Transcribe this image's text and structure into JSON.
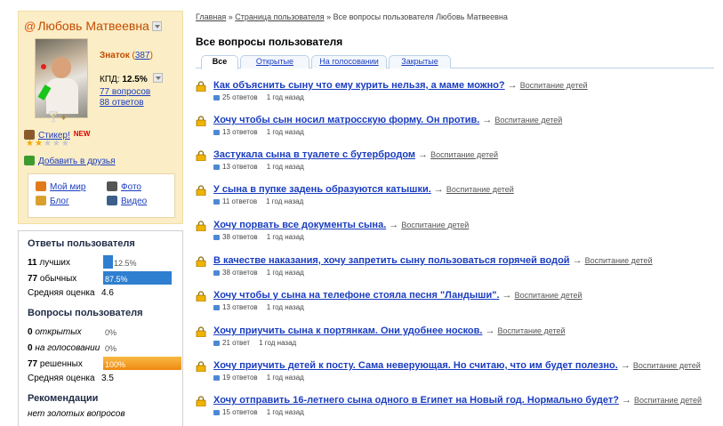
{
  "profile": {
    "name": "Любовь Матвеевна",
    "rank": "Знаток",
    "points": "387",
    "kpd_label": "КПД:",
    "kpd_value": "12.5%",
    "questions_link": "77 вопросов",
    "answers_link": "88 ответов",
    "sticker": "Стикер!",
    "sticker_badge": "NEW",
    "stars_on": 2,
    "stars_total": 5,
    "add_friend": "Добавить в друзья",
    "links": {
      "my_world": "Мой мир",
      "photo": "Фото",
      "blog": "Блог",
      "video": "Видео"
    }
  },
  "stats": {
    "answers_title": "Ответы пользователя",
    "best_count": "11",
    "best_label": "лучших",
    "best_pct": "12.5%",
    "best_fraction": 0.125,
    "usual_count": "77",
    "usual_label": "обычных",
    "usual_pct": "87.5%",
    "usual_fraction": 0.875,
    "avg_label": "Средняя оценка",
    "avg_answers": "4.6",
    "questions_title": "Вопросы пользователя",
    "open_count": "0",
    "open_label": "открытых",
    "open_pct": "0%",
    "vote_count": "0",
    "vote_label": "на голосовании",
    "vote_pct": "0%",
    "solved_count": "77",
    "solved_label": "решенных",
    "solved_pct": "100%",
    "solved_fraction": 1.0,
    "avg_questions": "3.5",
    "rec_title": "Рекомендации",
    "rec_text": "нет золотых вопросов"
  },
  "breadcrumb": {
    "home": "Главная",
    "sep": " » ",
    "user_page": "Страница пользователя",
    "current": "Все вопросы пользователя Любовь Матвеевна"
  },
  "page_title": "Все вопросы пользователя",
  "tabs": [
    "Все",
    "Открытые",
    "На голосовании",
    "Закрытые"
  ],
  "questions": [
    {
      "title": "Как объяснить сыну что ему курить нельзя, а маме можно?",
      "category": "Воспитание детей",
      "answers": "25 ответов",
      "time": "1 год назад"
    },
    {
      "title": "Хочу чтобы сын носил матросскую форму. Он против.",
      "category": "Воспитание детей",
      "answers": "13 ответов",
      "time": "1 год назад"
    },
    {
      "title": "Застукала сына в туалете с бутербродом",
      "category": "Воспитание детей",
      "answers": "13 ответов",
      "time": "1 год назад"
    },
    {
      "title": "У сына в пупке задень образуются катышки.",
      "category": "Воспитание детей",
      "answers": "11 ответов",
      "time": "1 год назад"
    },
    {
      "title": "Хочу порвать все документы сына.",
      "category": "Воспитание детей",
      "answers": "38 ответов",
      "time": "1 год назад"
    },
    {
      "title": "В качестве наказания, хочу запретить сыну пользоваться горячей водой",
      "category": "Воспитание детей",
      "answers": "38 ответов",
      "time": "1 год назад"
    },
    {
      "title": "Хочу чтобы у сына на телефоне стояла песня \"Ландыши\".",
      "category": "Воспитание детей",
      "answers": "13 ответов",
      "time": "1 год назад"
    },
    {
      "title": "Хочу приучить сына к портянкам. Они удобнее носков.",
      "category": "Воспитание детей",
      "answers": "21 ответ",
      "time": "1 год назад"
    },
    {
      "title": "Хочу приучить детей к посту. Сама неверующая. Но считаю, что им будет полезно.",
      "category": "Воспитание детей",
      "answers": "19 ответов",
      "time": "1 год назад"
    },
    {
      "title": "Хочу отправить 16-летнего сына одного в Египет на Новый год. Нормально будет?",
      "category": "Воспитание детей",
      "answers": "15 ответов",
      "time": "1 год назад"
    }
  ],
  "colors": {
    "link": "#1a3dc1",
    "profile_bg": "#fbedc5",
    "bar_blue": "#2f7fd0",
    "bar_orange": "#f39a1a"
  }
}
